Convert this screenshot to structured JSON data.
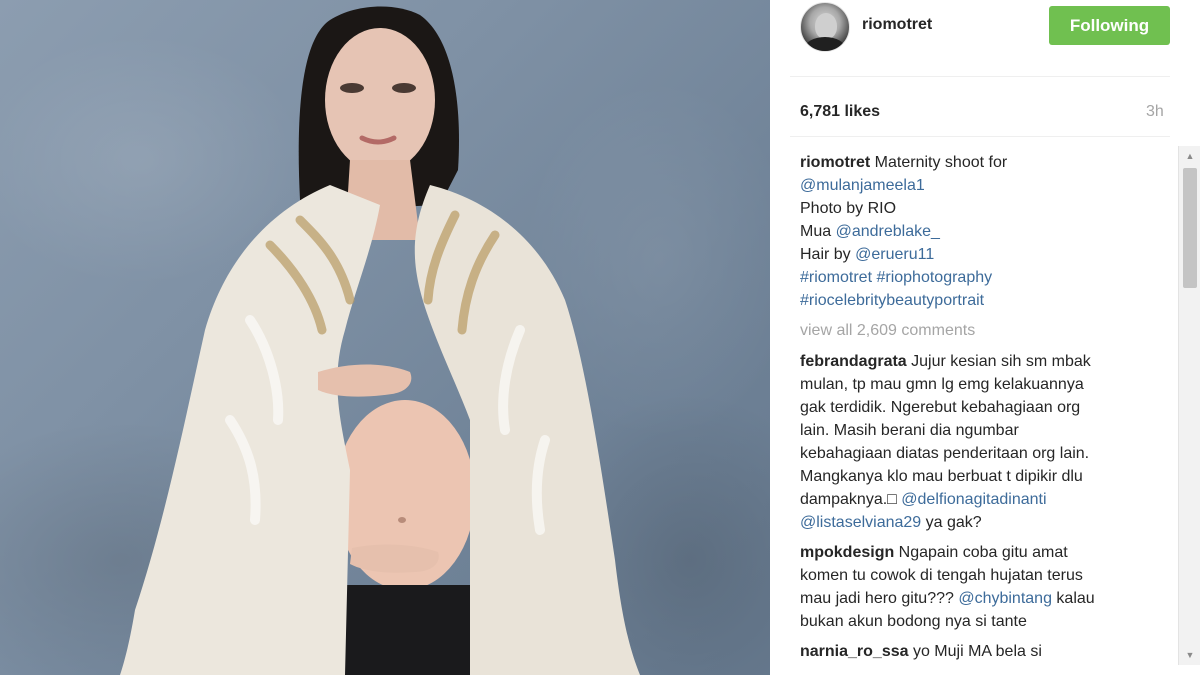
{
  "post": {
    "username": "riomotret",
    "follow_label": "Following",
    "likes": "6,781 likes",
    "time": "3h"
  },
  "caption": {
    "user": "riomotret",
    "text1": " Maternity shoot for",
    "mention1": "@mulanjameela1",
    "line2": "Photo by RIO",
    "mua_prefix": "Mua ",
    "mention2": "@andreblake_",
    "hair_prefix": "Hair by ",
    "mention3": "@erueru11",
    "tags1": "#riomotret #riophotography",
    "tags2": "#riocelebritybeautyportrait"
  },
  "view_all": "view all 2,609 comments",
  "comments": [
    {
      "user": "febrandagrata",
      "lines": [
        " Jujur kesian sih sm mbak",
        "mulan, tp mau gmn lg emg kelakuannya",
        "gak terdidik. Ngerebut kebahagiaan org",
        "lain. Masih berani dia ngumbar",
        "kebahagiaan diatas penderitaan org lain.",
        "Mangkanya klo mau berbuat t dipikir dlu"
      ],
      "tail_text": "dampaknya.□ ",
      "mention_a": "@delfionagitadinanti",
      "mention_b": "@listaselviana29",
      "tail_end": " ya gak?"
    },
    {
      "user": "mpokdesign",
      "lines": [
        " Ngapain coba gitu amat",
        "komen tu cowok di tengah hujatan terus",
        "mau jadi hero gitu??? "
      ],
      "mention_a": "@chybintang",
      "after_mention": " kalau",
      "last_line": "bukan akun bodong nya si tante"
    },
    {
      "user": "narnia_ro_ssa",
      "text": " yo Muji MA bela si"
    }
  ],
  "colors": {
    "follow_button": "#70c050",
    "link": "#3d6b9a",
    "muted": "#a5a5a5"
  },
  "icons": {
    "scroll_up": "triangle-up-icon",
    "scroll_down": "triangle-down-icon"
  }
}
